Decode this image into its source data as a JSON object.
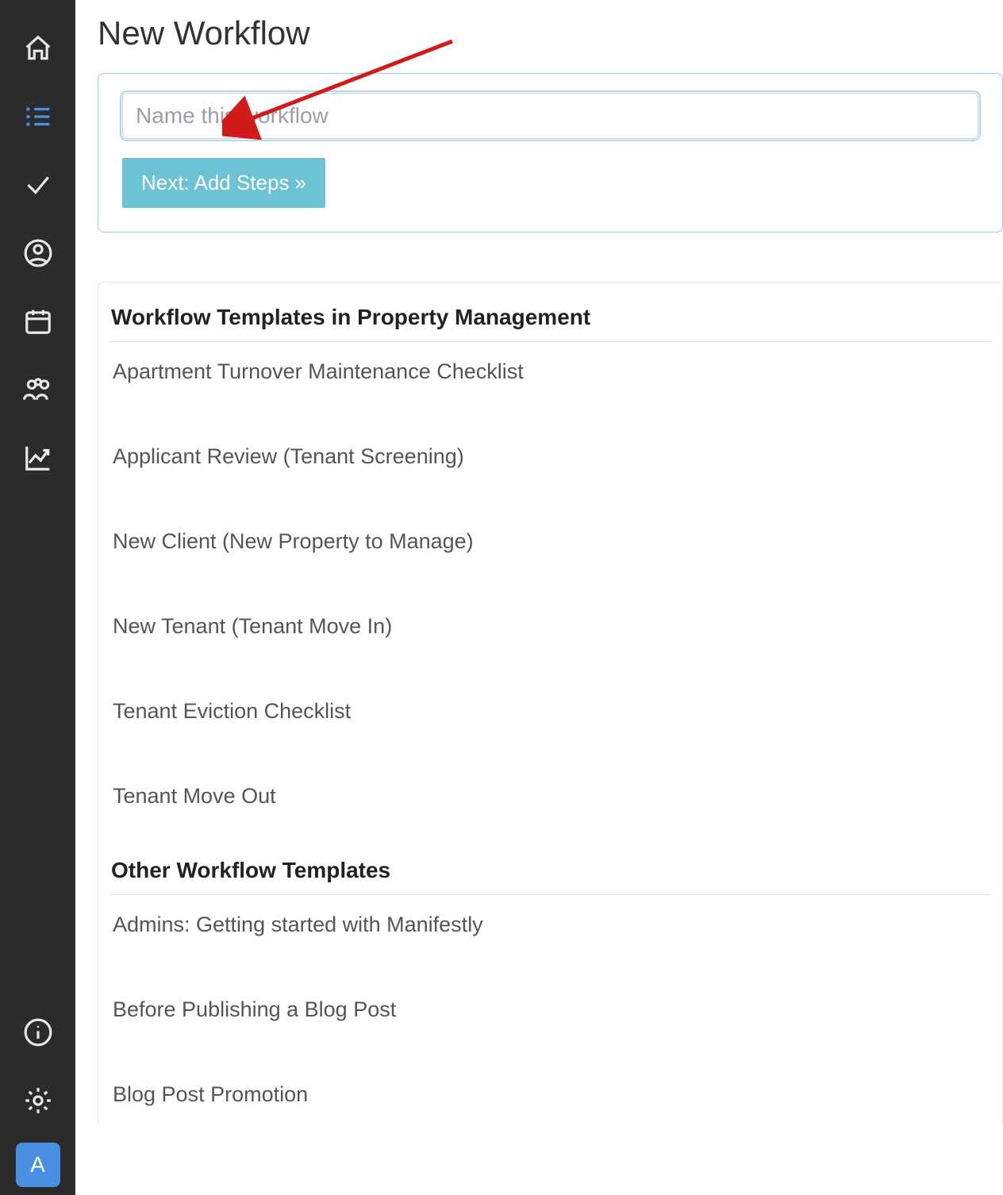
{
  "page": {
    "title": "New Workflow"
  },
  "form": {
    "name_placeholder": "Name this workflow",
    "next_button": "Next: Add Steps »"
  },
  "templates": {
    "section1_heading": "Workflow Templates in Property Management",
    "section1_items": [
      "Apartment Turnover Maintenance Checklist",
      "Applicant Review (Tenant Screening)",
      "New Client (New Property to Manage)",
      "New Tenant (Tenant Move In)",
      "Tenant Eviction Checklist",
      "Tenant Move Out"
    ],
    "section2_heading": "Other Workflow Templates",
    "section2_items": [
      "Admins: Getting started with Manifestly",
      "Before Publishing a Blog Post",
      "Blog Post Promotion"
    ]
  },
  "sidebar": {
    "avatar_letter": "A"
  }
}
